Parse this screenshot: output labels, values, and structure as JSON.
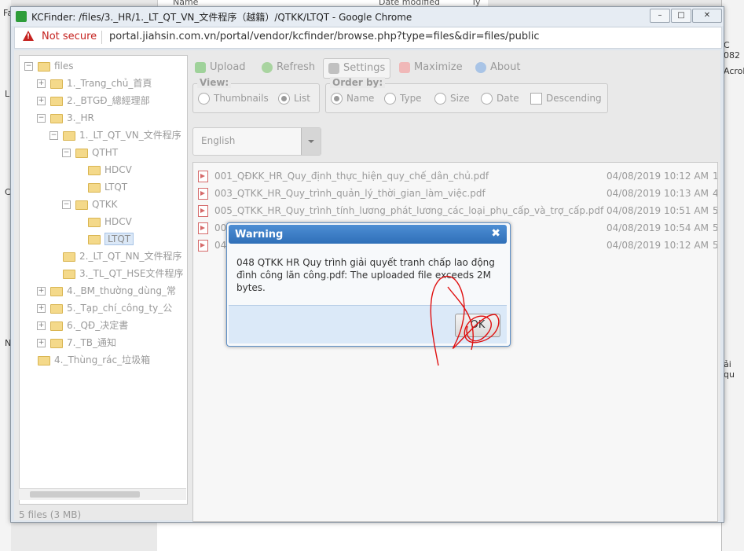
{
  "background": {
    "explorer_headers": [
      "Name",
      "Date modified",
      "Ty"
    ],
    "right_fragments": [
      "C 082",
      "Acrob",
      "ải qu"
    ],
    "left_fragments": [
      "Fa",
      "Li",
      "C",
      "N"
    ]
  },
  "window": {
    "title": "KCFinder: /files/3._HR/1._LT_QT_VN_文件程序（越籍）/QTKK/LTQT - Google Chrome",
    "controls": {
      "minimize": "–",
      "maximize": "□",
      "close": "✕"
    }
  },
  "address": {
    "security_label": "Not secure",
    "url": "portal.jiahsin.com.vn/portal/vendor/kcfinder/browse.php?type=files&dir=files/public"
  },
  "toolbar": {
    "upload": "Upload",
    "refresh": "Refresh",
    "settings": "Settings",
    "maximize": "Maximize",
    "about": "About"
  },
  "view": {
    "legend": "View:",
    "thumbnails": "Thumbnails",
    "list": "List"
  },
  "order": {
    "legend": "Order by:",
    "name": "Name",
    "type": "Type",
    "size": "Size",
    "date": "Date",
    "descending": "Descending"
  },
  "language": {
    "selected": "English"
  },
  "tree": [
    {
      "label": "files",
      "level": 0,
      "expander": "−"
    },
    {
      "label": "1._Trang_chủ_首頁",
      "level": 1,
      "expander": "+"
    },
    {
      "label": "2._BTGĐ_總經理部",
      "level": 1,
      "expander": "+"
    },
    {
      "label": "3._HR",
      "level": 1,
      "expander": "−"
    },
    {
      "label": "1._LT_QT_VN_文件程序",
      "level": 2,
      "expander": "−"
    },
    {
      "label": "QTHT",
      "level": 3,
      "expander": "−"
    },
    {
      "label": "HDCV",
      "level": 4,
      "expander": ""
    },
    {
      "label": "LTQT",
      "level": 4,
      "expander": ""
    },
    {
      "label": "QTKK",
      "level": 3,
      "expander": "−"
    },
    {
      "label": "HDCV",
      "level": 4,
      "expander": ""
    },
    {
      "label": "LTQT",
      "level": 4,
      "expander": "",
      "selected": true
    },
    {
      "label": "2._LT_QT_NN_文件程序",
      "level": 2,
      "expander": ""
    },
    {
      "label": "3._TL_QT_HSE文件程序",
      "level": 2,
      "expander": ""
    },
    {
      "label": "4._BM_thường_dùng_常",
      "level": 1,
      "expander": "+"
    },
    {
      "label": "5._Tạp_chí_công_ty_公",
      "level": 1,
      "expander": "+"
    },
    {
      "label": "6._QĐ_决定書",
      "level": 1,
      "expander": "+"
    },
    {
      "label": "7._TB_通知",
      "level": 1,
      "expander": "+"
    },
    {
      "label": "4._Thùng_rác_垃圾箱",
      "level": 0,
      "expander": ""
    }
  ],
  "status": "5 files (3 MB)",
  "files": [
    {
      "name": "001_QĐKK_HR_Quy_định_thực_hiện_quy_chế_dân_chủ.pdf",
      "date": "04/08/2019 10:12 AM",
      "size": "1"
    },
    {
      "name": "003_QTKK_HR_Quy_trình_quản_lý_thời_gian_làm_việc.pdf",
      "date": "04/08/2019 10:13 AM",
      "size": "4"
    },
    {
      "name": "005_QTKK_HR_Quy_trình_tính_lương_phát_lương_các_loại_phụ_cấp_và_trợ_cấp.pdf",
      "date": "04/08/2019 10:51 AM",
      "size": "5"
    },
    {
      "name": "006_QTKK_HR_Quy_trình_quản_lý_phần_mềm_nhân_sự.pdf",
      "date": "04/08/2019 10:54 AM",
      "size": "5"
    },
    {
      "name": "04",
      "date": "04/08/2019 10:12 AM",
      "size": "5"
    }
  ],
  "dialog": {
    "title": "Warning",
    "close": "✖",
    "message": "048 QTKK HR Quy trình giải quyết tranh chấp lao động đình công lãn công.pdf: The uploaded file exceeds 2M bytes.",
    "ok": "OK"
  },
  "colors": {
    "dialog_title": "#3a7cc6",
    "not_secure": "#c5221f",
    "scribble": "#e01010"
  }
}
